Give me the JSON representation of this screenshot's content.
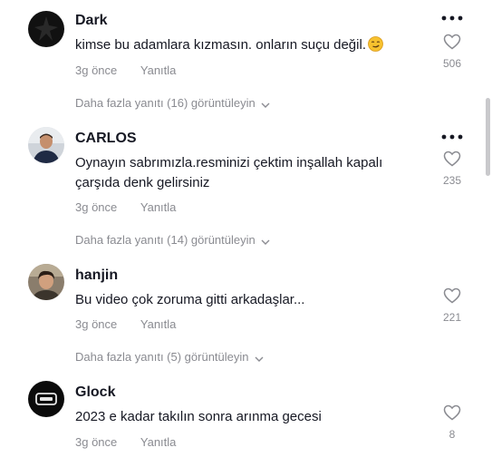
{
  "comments": [
    {
      "username": "Dark",
      "text": "kimse bu adamlara kızmasın. onların suçu değil.",
      "emoji": "smirk-emoji",
      "time": "3g önce",
      "reply_label": "Yanıtla",
      "likes": "506",
      "view_replies": "Daha fazla yanıtı (16) görüntüleyin"
    },
    {
      "username": "CARLOS",
      "text": "Oynayın sabrımızla.resminizi çektim inşallah kapalı çarşıda denk gelirsiniz",
      "time": "3g önce",
      "reply_label": "Yanıtla",
      "likes": "235",
      "view_replies": "Daha fazla yanıtı (14) görüntüleyin"
    },
    {
      "username": "hanjin",
      "text": "Bu video çok zoruma gitti arkadaşlar...",
      "time": "3g önce",
      "reply_label": "Yanıtla",
      "likes": "221",
      "view_replies": "Daha fazla yanıtı (5) görüntüleyin"
    },
    {
      "username": "Glock",
      "text": "2023 e kadar takılın sonra arınma gecesi",
      "time": "3g önce",
      "reply_label": "Yanıtla",
      "likes": "8"
    }
  ],
  "icons": {
    "more": "more-horizontal-icon",
    "like": "heart-outline-icon",
    "expand": "chevron-down-icon"
  },
  "colors": {
    "text": "#161823",
    "secondary": "#8a8b91",
    "background": "#ffffff"
  }
}
